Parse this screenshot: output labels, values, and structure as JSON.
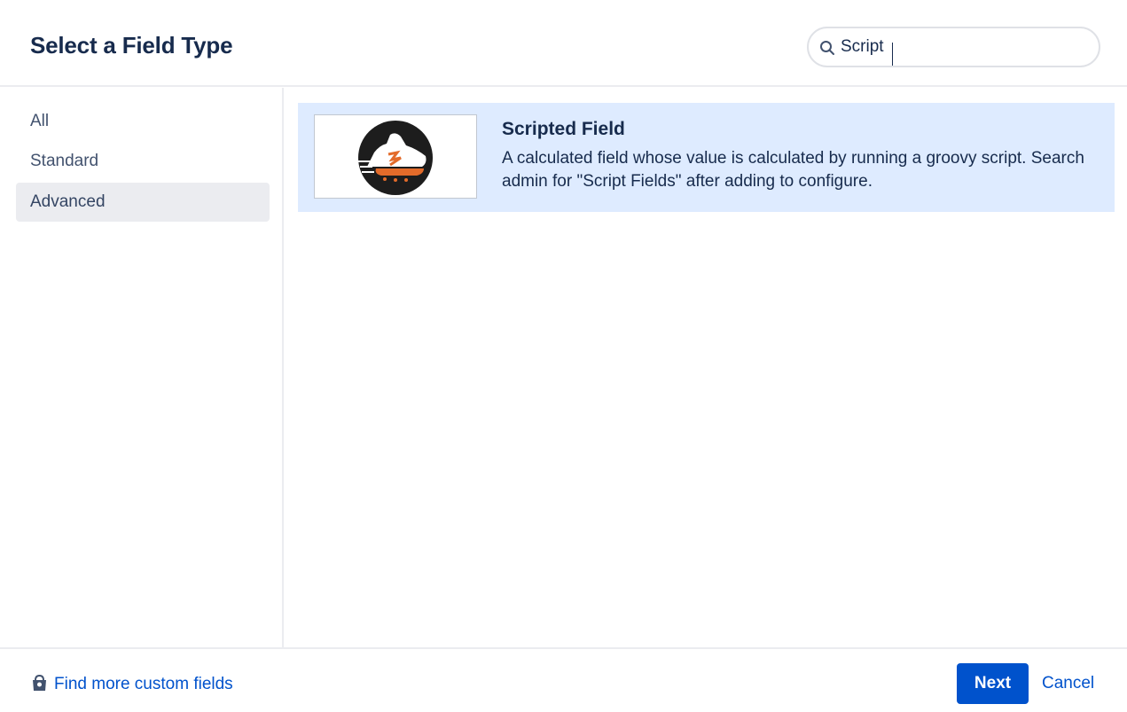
{
  "dialog": {
    "title": "Select a Field Type"
  },
  "search": {
    "value": "Script",
    "icon": "search-icon"
  },
  "sidebar": {
    "items": [
      {
        "label": "All",
        "selected": false
      },
      {
        "label": "Standard",
        "selected": false
      },
      {
        "label": "Advanced",
        "selected": true
      }
    ]
  },
  "results": [
    {
      "title": "Scripted Field",
      "description": "A calculated field whose value is calculated by running a groovy script. Search admin for \"Script Fields\" after adding to configure.",
      "icon": "running-shoe-icon"
    }
  ],
  "footer": {
    "find_more_label": "Find more custom fields",
    "find_more_icon": "shopping-bag-icon",
    "next_label": "Next",
    "cancel_label": "Cancel"
  },
  "colors": {
    "accent": "#0052cc",
    "selected_row": "#deebff",
    "selected_nav": "#ebecf0",
    "text": "#172b4d"
  }
}
